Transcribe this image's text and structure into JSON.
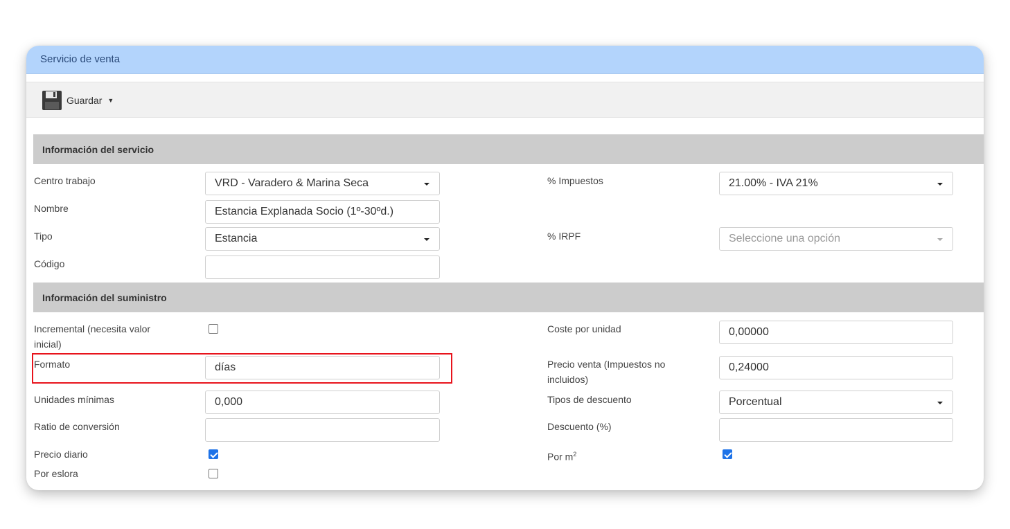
{
  "panel": {
    "title": "Servicio de venta"
  },
  "toolbar": {
    "save_label": "Guardar"
  },
  "section_service": {
    "title": "Información del servicio",
    "centro_label": "Centro trabajo",
    "centro_value": "VRD - Varadero & Marina Seca",
    "nombre_label": "Nombre",
    "nombre_value": "Estancia Explanada Socio (1º-30ºd.)",
    "tipo_label": "Tipo",
    "tipo_value": "Estancia",
    "codigo_label": "Código",
    "codigo_value": "",
    "impuestos_label": "% Impuestos",
    "impuestos_value": "21.00% - IVA 21%",
    "irpf_label": "% IRPF",
    "irpf_placeholder": "Seleccione una opción"
  },
  "section_supply": {
    "title": "Información del suministro",
    "incremental_label_1": "Incremental (necesita valor",
    "incremental_label_2": "inicial)",
    "incremental_checked": false,
    "formato_label": "Formato",
    "formato_value": "días",
    "unidades_label": "Unidades mínimas",
    "unidades_value": "0,000",
    "ratio_label": "Ratio de conversión",
    "ratio_value": "",
    "precio_diario_label": "Precio diario",
    "precio_diario_checked": true,
    "por_eslora_label": "Por eslora",
    "por_eslora_checked": false,
    "coste_label": "Coste por unidad",
    "coste_value": "0,00000",
    "precio_venta_label_1": "Precio venta (Impuestos no",
    "precio_venta_label_2": "incluidos)",
    "precio_venta_value": "0,24000",
    "tipos_desc_label": "Tipos de descuento",
    "tipos_desc_value": "Porcentual",
    "descuento_label": "Descuento (%)",
    "descuento_value": "",
    "por_m2_label": "Por m",
    "por_m2_sup": "2",
    "por_m2_checked": true
  },
  "colors": {
    "header_bg": "#b3d4fc",
    "section_bg": "#cccccc",
    "checkbox_checked": "#1e73e8",
    "highlight": "#e8131c"
  }
}
